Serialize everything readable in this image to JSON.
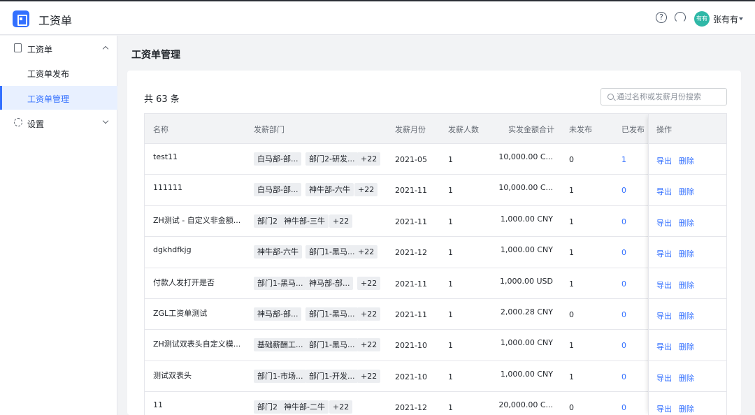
{
  "app": {
    "title": "工资单"
  },
  "header": {
    "avatar_text": "有有",
    "user_name": "张有有"
  },
  "sidebar": {
    "group_payroll": "工资单",
    "items": [
      {
        "label": "工资单发布"
      },
      {
        "label": "工资单管理"
      }
    ],
    "group_settings": "设置"
  },
  "main": {
    "page_title": "工资单管理",
    "total": "共 63 条",
    "search_placeholder": "通过名称或发薪月份搜索"
  },
  "table": {
    "headers": {
      "name": "名称",
      "dept": "发薪部门",
      "month": "发薪月份",
      "count": "发薪人数",
      "amount": "实发金额合计",
      "unpublished": "未发布",
      "published": "已发布",
      "ops": "操作"
    },
    "op_export": "导出",
    "op_delete": "删除",
    "rows": [
      {
        "name": "test11",
        "tags": [
          "白马部-部...",
          "部门2-研发...",
          "+22"
        ],
        "month": "2021-05",
        "count": "1",
        "amount": "10,000.00 C...",
        "unpublished": "0",
        "published": "1"
      },
      {
        "name": "111111",
        "tags": [
          "白马部-部...",
          "神牛部-六牛",
          "+22"
        ],
        "month": "2021-11",
        "count": "1",
        "amount": "10,000.00 C...",
        "unpublished": "1",
        "published": "0"
      },
      {
        "name": "ZH测试 - 自定义非金额...",
        "tags": [
          "部门2",
          "神牛部-三牛",
          "+22"
        ],
        "month": "2021-11",
        "count": "1",
        "amount": "1,000.00 CNY",
        "unpublished": "1",
        "published": "0"
      },
      {
        "name": "dgkhdfkjg",
        "tags": [
          "神牛部-六牛",
          "部门1-黑马...",
          "+22"
        ],
        "month": "2021-12",
        "count": "1",
        "amount": "1,000.00 CNY",
        "unpublished": "1",
        "published": "0"
      },
      {
        "name": "付款人发打开是否",
        "tags": [
          "部门1-黑马...",
          "神马部-部...",
          "+22"
        ],
        "month": "2021-11",
        "count": "1",
        "amount": "1,000.00 USD",
        "unpublished": "1",
        "published": "0"
      },
      {
        "name": "ZGL工资单测试",
        "tags": [
          "神马部-部...",
          "部门1-黑马...",
          "+22"
        ],
        "month": "2021-11",
        "count": "1",
        "amount": "2,000.28 CNY",
        "unpublished": "0",
        "published": "0"
      },
      {
        "name": "ZH测试双表头自定义模...",
        "tags": [
          "基础薪酬工...",
          "部门1-黑马...",
          "+22"
        ],
        "month": "2021-10",
        "count": "1",
        "amount": "1,000.00 CNY",
        "unpublished": "1",
        "published": "0"
      },
      {
        "name": "测试双表头",
        "tags": [
          "部门1-市场...",
          "部门1-开发...",
          "+22"
        ],
        "month": "2021-10",
        "count": "1",
        "amount": "1,000.00 CNY",
        "unpublished": "1",
        "published": "0"
      },
      {
        "name": "11",
        "tags": [
          "部门2",
          "神牛部-二牛",
          "+22"
        ],
        "month": "2021-12",
        "count": "1",
        "amount": "20,000.00 C...",
        "unpublished": "0",
        "published": "0"
      }
    ]
  }
}
